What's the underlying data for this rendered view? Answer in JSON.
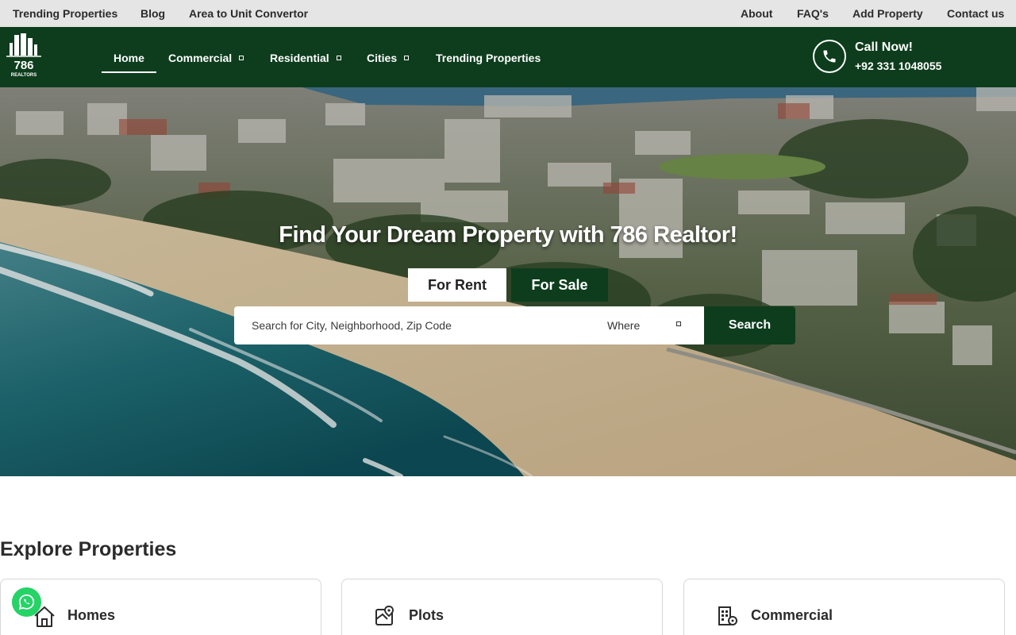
{
  "topbar": {
    "left_links": [
      "Trending Properties",
      "Blog",
      "Area to Unit Convertor"
    ],
    "right_links": [
      "About",
      "FAQ's",
      "Add Property",
      "Contact us"
    ]
  },
  "brand": {
    "logo_number": "786",
    "logo_text": "REALTORS"
  },
  "nav": {
    "items": [
      {
        "label": "Home",
        "active": true,
        "dropdown": false
      },
      {
        "label": "Commercial",
        "active": false,
        "dropdown": true
      },
      {
        "label": "Residential",
        "active": false,
        "dropdown": true
      },
      {
        "label": "Cities",
        "active": false,
        "dropdown": true
      },
      {
        "label": "Trending Properties",
        "active": false,
        "dropdown": false
      }
    ],
    "call_title": "Call Now!",
    "call_number": "+92 331 1048055"
  },
  "hero": {
    "title": "Find Your Dream Property with 786 Realtor!",
    "tab_rent": "For Rent",
    "tab_sale": "For Sale",
    "search_placeholder": "Search for City, Neighborhood, Zip Code",
    "where_label": "Where",
    "search_button": "Search"
  },
  "explore": {
    "title": "Explore Properties",
    "cards": [
      {
        "label": "Homes",
        "icon": "home-icon"
      },
      {
        "label": "Plots",
        "icon": "map-pin-icon"
      },
      {
        "label": "Commercial",
        "icon": "building-icon"
      }
    ]
  },
  "colors": {
    "brand_green": "#0d3d1d",
    "topbar_bg": "#e5e5e5",
    "whatsapp_green": "#25d366"
  }
}
